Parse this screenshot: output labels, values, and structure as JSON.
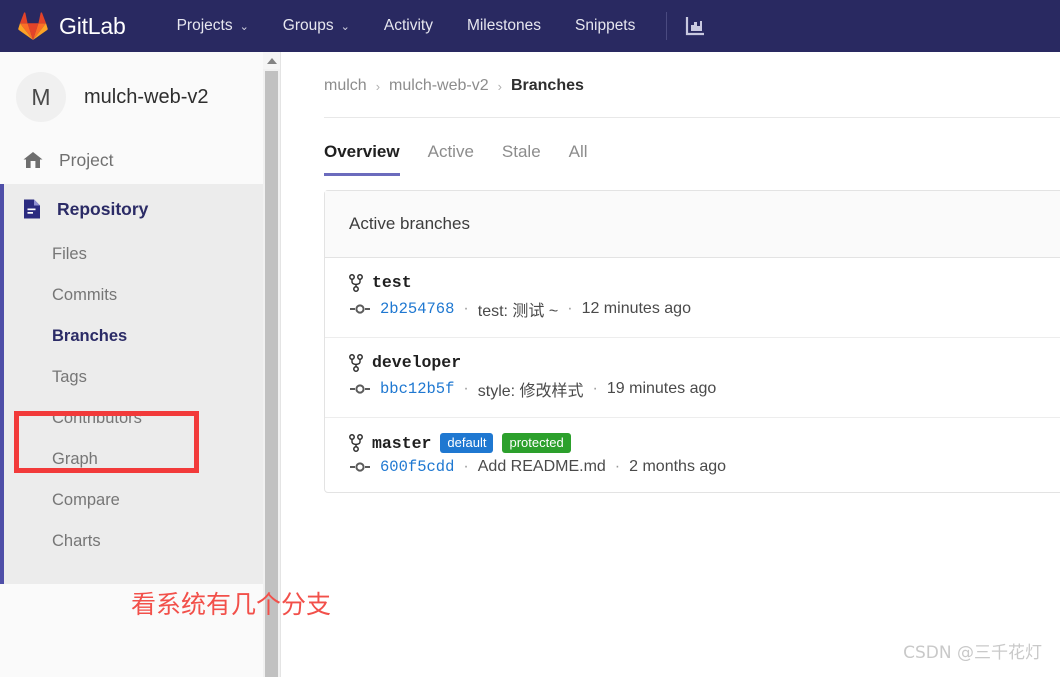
{
  "navbar": {
    "brand": "GitLab",
    "items": [
      {
        "label": "Projects",
        "has_caret": true
      },
      {
        "label": "Groups",
        "has_caret": true
      },
      {
        "label": "Activity",
        "has_caret": false
      },
      {
        "label": "Milestones",
        "has_caret": false
      },
      {
        "label": "Snippets",
        "has_caret": false
      }
    ],
    "caret": "⌄",
    "analytics_icon": "chart-icon",
    "background": "#292961"
  },
  "sidebar": {
    "project": {
      "avatar_letter": "M",
      "name": "mulch-web-v2"
    },
    "home": {
      "label": "Project",
      "icon": "home-icon"
    },
    "section": {
      "label": "Repository",
      "icon": "document-icon",
      "accent": "#4f4fa8"
    },
    "items": [
      {
        "label": "Files",
        "active": false
      },
      {
        "label": "Commits",
        "active": false
      },
      {
        "label": "Branches",
        "active": true
      },
      {
        "label": "Tags",
        "active": false
      },
      {
        "label": "Contributors",
        "active": false
      },
      {
        "label": "Graph",
        "active": false
      },
      {
        "label": "Compare",
        "active": false
      },
      {
        "label": "Charts",
        "active": false
      }
    ],
    "scrollbar": {
      "arrow": "up-arrow-icon"
    }
  },
  "annotations": {
    "box_target": "Branches",
    "box_color": "#f23a3a",
    "note_text": "看系统有几个分支",
    "note_color": "#f2504a"
  },
  "breadcrumb": {
    "items": [
      {
        "label": "mulch",
        "current": false
      },
      {
        "label": "mulch-web-v2",
        "current": false
      },
      {
        "label": "Branches",
        "current": true
      }
    ],
    "separator": "›"
  },
  "tabs": [
    {
      "label": "Overview",
      "active": true
    },
    {
      "label": "Active",
      "active": false
    },
    {
      "label": "Stale",
      "active": false
    },
    {
      "label": "All",
      "active": false
    }
  ],
  "branch_panel": {
    "heading": "Active branches",
    "branch_icon": "branch-fork-icon",
    "commit_icon": "commit-node-icon",
    "separator": "·",
    "branches": [
      {
        "name": "test",
        "badges": [],
        "sha": "2b254768",
        "message": "test: 测试 ~",
        "time": "12 minutes ago"
      },
      {
        "name": "developer",
        "badges": [],
        "sha": "bbc12b5f",
        "message": "style: 修改样式",
        "time": "19 minutes ago"
      },
      {
        "name": "master",
        "badges": [
          {
            "label": "default",
            "color": "#1f78d1"
          },
          {
            "label": "protected",
            "color": "#2ca02c"
          }
        ],
        "sha": "600f5cdd",
        "message": "Add README.md",
        "time": "2 months ago"
      }
    ]
  },
  "watermark": {
    "text": "CSDN @三千花灯"
  }
}
